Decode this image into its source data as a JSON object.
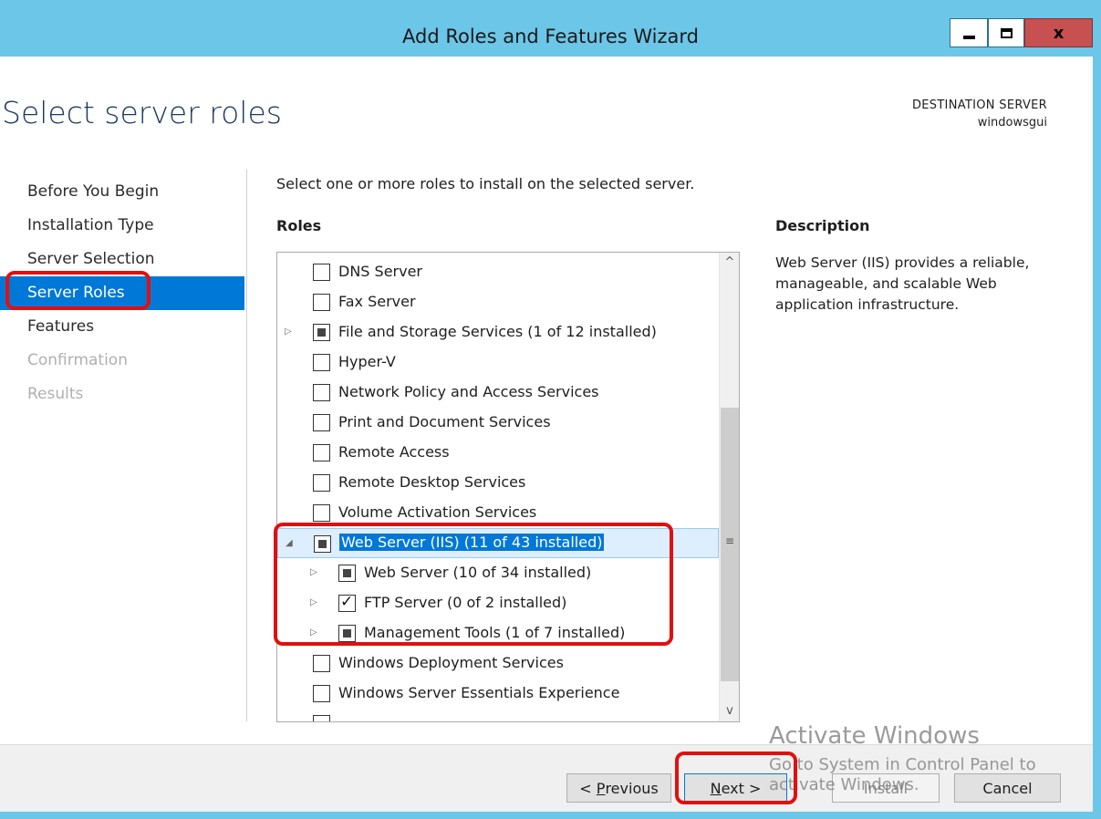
{
  "window": {
    "title": "Add Roles and Features Wizard",
    "close_glyph": "x"
  },
  "header": {
    "page_title": "Select server roles",
    "destination_label": "DESTINATION SERVER",
    "destination_server": "windowsgui"
  },
  "nav": {
    "items": [
      {
        "label": "Before You Begin",
        "state": "normal"
      },
      {
        "label": "Installation Type",
        "state": "normal"
      },
      {
        "label": "Server Selection",
        "state": "normal"
      },
      {
        "label": "Server Roles",
        "state": "active"
      },
      {
        "label": "Features",
        "state": "normal"
      },
      {
        "label": "Confirmation",
        "state": "disabled"
      },
      {
        "label": "Results",
        "state": "disabled"
      }
    ]
  },
  "main": {
    "instruction": "Select one or more roles to install on the selected server.",
    "roles_header": "Roles",
    "description_header": "Description",
    "description_text": "Web Server (IIS) provides a reliable, manageable, and scalable Web application infrastructure.",
    "roles": [
      {
        "label": "DNS Server",
        "level": 0,
        "expander": "",
        "check": "unchecked"
      },
      {
        "label": "Fax Server",
        "level": 0,
        "expander": "",
        "check": "unchecked"
      },
      {
        "label": "File and Storage Services (1 of 12 installed)",
        "level": 0,
        "expander": "▷",
        "check": "partial"
      },
      {
        "label": "Hyper-V",
        "level": 0,
        "expander": "",
        "check": "unchecked"
      },
      {
        "label": "Network Policy and Access Services",
        "level": 0,
        "expander": "",
        "check": "unchecked"
      },
      {
        "label": "Print and Document Services",
        "level": 0,
        "expander": "",
        "check": "unchecked"
      },
      {
        "label": "Remote Access",
        "level": 0,
        "expander": "",
        "check": "unchecked"
      },
      {
        "label": "Remote Desktop Services",
        "level": 0,
        "expander": "",
        "check": "unchecked"
      },
      {
        "label": "Volume Activation Services",
        "level": 0,
        "expander": "",
        "check": "unchecked"
      },
      {
        "label": "Web Server (IIS) (11 of 43 installed)",
        "level": 0,
        "expander": "◢",
        "check": "partial",
        "selected": true
      },
      {
        "label": "Web Server (10 of 34 installed)",
        "level": 1,
        "expander": "▷",
        "check": "partial"
      },
      {
        "label": "FTP Server (0 of 2 installed)",
        "level": 1,
        "expander": "▷",
        "check": "checked"
      },
      {
        "label": "Management Tools (1 of 7 installed)",
        "level": 1,
        "expander": "▷",
        "check": "partial"
      },
      {
        "label": "Windows Deployment Services",
        "level": 0,
        "expander": "",
        "check": "unchecked"
      },
      {
        "label": "Windows Server Essentials Experience",
        "level": 0,
        "expander": "",
        "check": "unchecked"
      },
      {
        "label": "",
        "level": 0,
        "expander": "",
        "check": "unchecked"
      }
    ]
  },
  "scrollbar": {
    "up_glyph": "^",
    "down_glyph": "v",
    "grip_glyph": "≡"
  },
  "footer": {
    "previous_label": "Previous",
    "previous_prefix": "< ",
    "previous_accel": "P",
    "previous_rest": "revious",
    "next_accel": "N",
    "next_rest": "ext >",
    "install_label": "Install",
    "cancel_label": "Cancel"
  },
  "watermark": {
    "line1": "Activate Windows",
    "line2": "Go to System in Control Panel to activate Windows."
  },
  "colors": {
    "titlebar": "#6cc6e8",
    "nav_active": "#0078d7",
    "annotation": "#e01010",
    "close_button": "#c75050"
  }
}
